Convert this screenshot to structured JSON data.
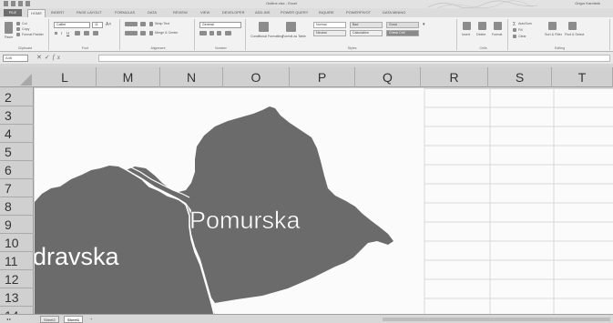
{
  "titlebar": {
    "title": "Outline.xlsx - Excel",
    "user": "Grigor Karnitnik"
  },
  "tabs": [
    "FILE",
    "HOME",
    "INSERT",
    "PAGE LAYOUT",
    "FORMULAS",
    "DATA",
    "REVIEW",
    "VIEW",
    "DEVELOPER",
    "ADD-INS",
    "POWER QUERY",
    "INQUIRE",
    "POWERPIVOT",
    "DATA MINING"
  ],
  "active_tab": "HOME",
  "ribbon": {
    "clipboard": {
      "paste": "Paste",
      "cut": "Cut",
      "copy": "Copy",
      "format_painter": "Format Painter",
      "name": "Clipboard"
    },
    "font": {
      "family": "Calibri",
      "size": "11",
      "bold": "B",
      "italic": "I",
      "underline": "U",
      "name": "Font"
    },
    "alignment": {
      "wrap": "Wrap Text",
      "merge": "Merge & Center",
      "name": "Alignment"
    },
    "number": {
      "format": "General",
      "name": "Number"
    },
    "styles": {
      "conditional": "Conditional Formatting",
      "format_table": "Format as Table",
      "normal": "Normal",
      "bad": "Bad",
      "good": "Good",
      "neutral": "Neutral",
      "calculation": "Calculation",
      "check_cell": "Check Cell",
      "name": "Styles"
    },
    "cells": {
      "insert": "Insert",
      "delete": "Delete",
      "format": "Format",
      "name": "Cells"
    },
    "editing": {
      "autosum": "AutoSum",
      "fill": "Fill",
      "clear": "Clear",
      "sort": "Sort & Filter",
      "find": "Find & Select",
      "name": "Editing"
    }
  },
  "formula_bar": {
    "name_box": "A46",
    "value": ""
  },
  "columns": [
    "L",
    "M",
    "N",
    "O",
    "P",
    "Q",
    "R",
    "S",
    "T"
  ],
  "rows": [
    "2",
    "3",
    "4",
    "5",
    "6",
    "7",
    "8",
    "9",
    "10",
    "11",
    "12",
    "13",
    "14"
  ],
  "map": {
    "labels": {
      "pomurska": "Pomurska",
      "podravska": "dravska"
    },
    "region_color": "#6b6b6b",
    "border_color": "#ffffff"
  },
  "sheets": {
    "tab1": "Sheet2",
    "tab2": "Sheet1",
    "add": "+"
  }
}
